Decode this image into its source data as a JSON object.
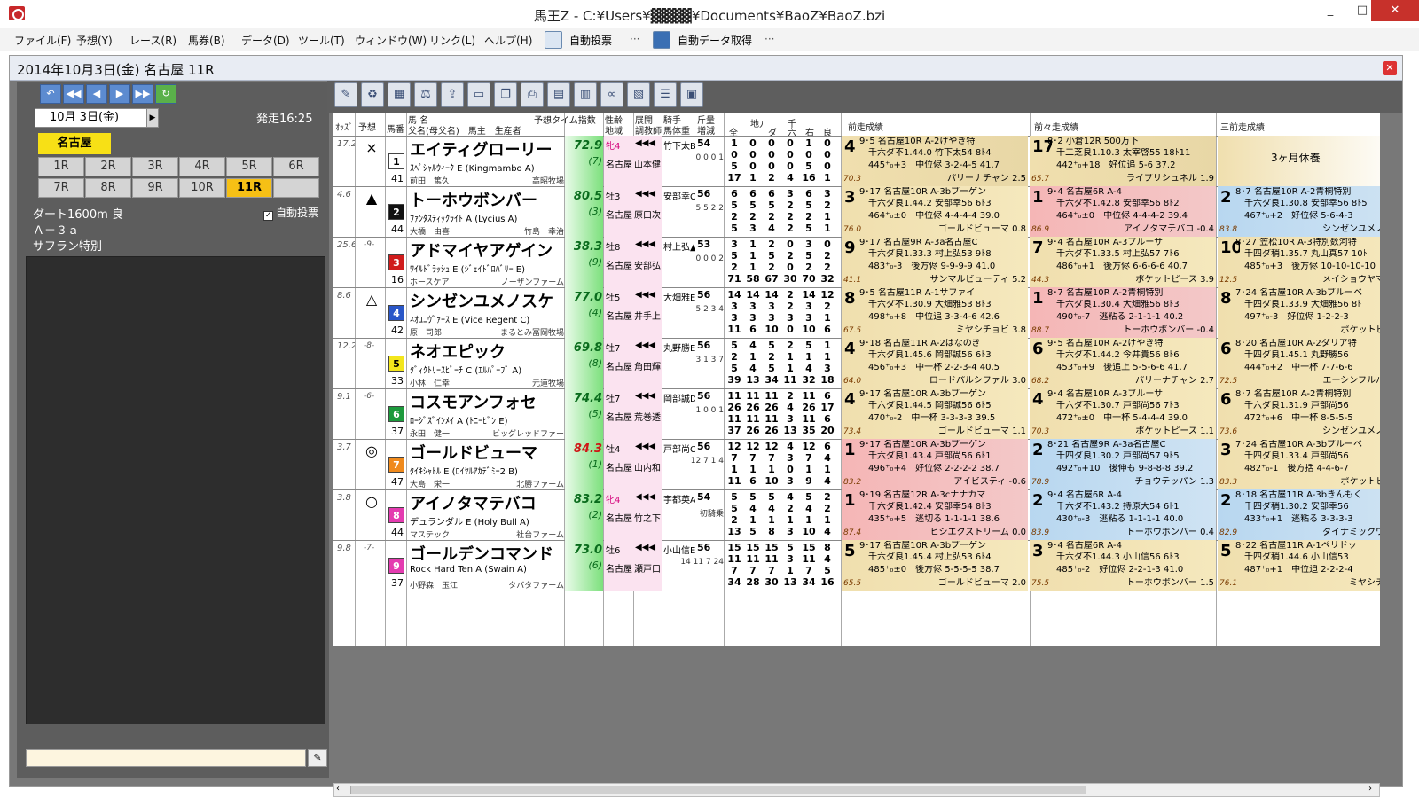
{
  "window": {
    "title": "馬王Z - C:¥Users¥▓▓▓▓¥Documents¥BaoZ¥BaoZ.bzi",
    "min": "_",
    "max": "□",
    "close": "✕"
  },
  "menu": [
    "ファイル(F)",
    "予想(Y)",
    "レース(R)",
    "馬券(B)",
    "データ(D)",
    "ツール(T)",
    "ウィンドウ(W)",
    "リンク(L)",
    "ヘルプ(H)"
  ],
  "toolbar": {
    "autovote": "自動投票",
    "autodata": "自動データ取得",
    "dots": "···"
  },
  "race": {
    "title": "2014年10月3日(金) 名古屋 11R",
    "date": "10月 3日(金)",
    "post_time": "発走16:25",
    "venue": "名古屋",
    "course": "ダート1600m 良",
    "class": "Ａ－３ａ",
    "name": "サフラン特別",
    "auto_vote": "自動投票"
  },
  "races": [
    "1R",
    "2R",
    "3R",
    "4R",
    "5R",
    "6R",
    "7R",
    "8R",
    "9R",
    "10R",
    "11R",
    ""
  ],
  "selected_race": "11R",
  "colors": {
    "accent": "#f6c015",
    "venue": "#f7e016",
    "index_green": "#7ce07c"
  },
  "header": {
    "odds": "ｵｯｽﾞ",
    "yoso": "予想",
    "waku": "馬番",
    "name": "馬 名",
    "sire": "父名(母父名)　馬主　生産者",
    "tindex": "予想タイム指数",
    "sexage": "性齢",
    "chiiki": "地域",
    "kyakushitsu": "展開",
    "chokyo": "調教師",
    "kishu": "騎手",
    "bataiju": "馬体重",
    "kinryo": "斤量",
    "zogen": "増減",
    "all": "全",
    "chiho": "地方",
    "da": "ダ",
    "sen": "千",
    "roku": "六",
    "migi": "右",
    "ryo": "良",
    "prev1": "前走成績",
    "prev2": "前々走成績",
    "prev3": "三前走成績"
  },
  "horses": [
    {
      "odds": "17.2",
      "pop": "",
      "mark": "×",
      "num": "1",
      "num_bg": "#ffffff",
      "num_fg": "#000",
      "weight_age": "41",
      "name": "エイティグローリー",
      "sire": "ｽﾍﾟｼｬﾙｳｨｰｸ E (Kingmambo A)",
      "owner": "前田　篤久",
      "breeder": "高昭牧場",
      "index": "72.9",
      "index_pop": "(7)",
      "sex": "牝4",
      "sex_pink": true,
      "area": "名古屋",
      "trainer": "山本健",
      "jockey": "竹下太B",
      "kin": "54",
      "body": "0 0 0 1",
      "stats": [
        [
          "1",
          "0",
          "0",
          "0",
          "1",
          "0"
        ],
        [
          "0",
          "0",
          "0",
          "0",
          "0",
          "0"
        ],
        [
          "5",
          "0",
          "0",
          "0",
          "5",
          "0"
        ],
        [
          "17",
          "1",
          "2",
          "4",
          "16",
          "1"
        ]
      ],
      "p1": {
        "pos": "4",
        "l1": "9･5 名古屋10R A-2けやき特",
        "l2": "千六ダ不1.44.0 竹下太54 8ﾄ4",
        "l3": "445⁺₀+3　中位侭 3-2-4-5 41.7",
        "l4": "パリーナチャン 2.5",
        "r": "70.3",
        "bg": "#e8d7a6"
      },
      "p2": {
        "pos": "17",
        "l1": "8･2 小倉12R 500万下",
        "l2": "千二芝良1.10.3 太宰啓55 18ﾄ11",
        "l3": "442⁺₀+18　好位追 5-6 37.2",
        "l4": "ライブリシュネル 1.9",
        "r": "65.7",
        "bg": "#e8d7a6"
      },
      "p3": {
        "pos": "",
        "l1": "",
        "l2": "3ヶ月休養",
        "l3": "",
        "l4": "",
        "r": "",
        "bg": "#ffffff"
      }
    },
    {
      "odds": "4.6",
      "pop": "",
      "mark": "▲",
      "num": "2",
      "num_bg": "#111111",
      "num_fg": "#fff",
      "weight_age": "44",
      "name": "トーホウボンバー",
      "sire": "ﾌｧﾝﾀｽﾃｨｯｸﾗｲﾄ A (Lycius A)",
      "owner": "大橋　由喜",
      "breeder": "竹島　幸治",
      "index": "80.5",
      "index_pop": "(3)",
      "sex": "牡3",
      "sex_pink": false,
      "area": "名古屋",
      "trainer": "原口次",
      "jockey": "安部幸C",
      "kin": "56",
      "body": "5 5 2 2",
      "stats": [
        [
          "6",
          "6",
          "6",
          "3",
          "6",
          "3"
        ],
        [
          "5",
          "5",
          "5",
          "2",
          "5",
          "2"
        ],
        [
          "2",
          "2",
          "2",
          "2",
          "2",
          "1"
        ],
        [
          "5",
          "3",
          "4",
          "2",
          "5",
          "1"
        ]
      ],
      "p1": {
        "pos": "3",
        "l1": "9･17 名古屋10R A-3bブーゲン",
        "l2": "千六ダ良1.44.2 安部幸56 6ﾄ3",
        "l3": "464⁺₀±0　中位侭 4-4-4-4 39.0",
        "l4": "ゴールドビューマ 0.8",
        "r": "76.0",
        "bg": "#f5e8bd"
      },
      "p2": {
        "pos": "1",
        "l1": "9･4 名古屋6R A-4",
        "l2": "千六ダ不1.42.8 安部幸56 8ﾄ2",
        "l3": "464⁺₀±0　中位侭 4-4-4-2 39.4",
        "l4": "アイノタマテバコ -0.4",
        "r": "86.9",
        "bg": "#f3c8c8"
      },
      "p3": {
        "pos": "2",
        "l1": "8･7 名古屋10R A-2青桐特別",
        "l2": "千六ダ良1.30.8 安部幸56 8ﾄ5",
        "l3": "467⁺₀+2　好位侭 5-6-4-3 ",
        "l4": "シンゼンユメノスク",
        "r": "83.8",
        "bg": "#cfe3f3"
      }
    },
    {
      "odds": "25.6",
      "pop": "-9-",
      "mark": "",
      "num": "3",
      "num_bg": "#d01c1c",
      "num_fg": "#fff",
      "weight_age": "16",
      "name": "アドマイヤアゲイン",
      "sire": "ﾜｲﾙﾄﾞﾗｯｼｭ E (ｼﾞｪｲﾄﾞﾛﾊﾞﾘｰ E)",
      "owner": "ホースケア",
      "breeder": "ノーザンファーム",
      "index": "38.3",
      "index_pop": "(9)",
      "sex": "牡8",
      "sex_pink": false,
      "area": "名古屋",
      "trainer": "安部弘",
      "jockey": "村上弘▲",
      "kin": "53",
      "body": "0 0 0 2",
      "stats": [
        [
          "3",
          "1",
          "2",
          "0",
          "3",
          "0"
        ],
        [
          "5",
          "1",
          "5",
          "2",
          "5",
          "2"
        ],
        [
          "2",
          "1",
          "2",
          "0",
          "2",
          "2"
        ],
        [
          "71",
          "58",
          "67",
          "30",
          "70",
          "32"
        ]
      ],
      "p1": {
        "pos": "9",
        "l1": "9･17 名古屋9R A-3a名古屋C",
        "l2": "千六ダ良1.33.3 村上弘53 9ﾄ8",
        "l3": "483⁺₀-3　後方侭 9-9-9-9 41.0",
        "l4": "サンマルビューティ 5.2",
        "r": "41.1",
        "bg": "#f5e8bd"
      },
      "p2": {
        "pos": "7",
        "l1": "9･4 名古屋10R A-3ブルーサ",
        "l2": "千六ダ不1.33.5 村上弘57 7ﾄ6",
        "l3": "486⁺₀+1　後方侭 6-6-6-6 40.7",
        "l4": "ポケットピース 3.9",
        "r": "44.3",
        "bg": "#f5e8bd"
      },
      "p3": {
        "pos": "10",
        "l1": "8･27 笠松10R A-3特別数河特",
        "l2": "千四ダ稍1.35.7 丸山真57 10ﾄ",
        "l3": "485⁺₀+3　後方侭 10-10-10-10",
        "l4": "メイショウヤマナミ",
        "r": "12.5",
        "bg": "#f5e8bd"
      }
    },
    {
      "odds": "8.6",
      "pop": "",
      "mark": "△",
      "num": "4",
      "num_bg": "#2a57c8",
      "num_fg": "#fff",
      "weight_age": "42",
      "name": "シンゼンユメノスケ",
      "sire": "ﾈｵﾕﾆｳﾞｧｰｽ E (Vice Regent C)",
      "owner": "原　司郎",
      "breeder": "まるとみ冨岡牧場",
      "index": "77.0",
      "index_pop": "(4)",
      "sex": "牡5",
      "sex_pink": false,
      "area": "名古屋",
      "trainer": "井手上",
      "jockey": "大畑雅E",
      "kin": "56",
      "body": "5 2 3 4",
      "stats": [
        [
          "14",
          "14",
          "14",
          "2",
          "14",
          "12"
        ],
        [
          "3",
          "3",
          "3",
          "2",
          "3",
          "2"
        ],
        [
          "3",
          "3",
          "3",
          "3",
          "3",
          "1"
        ],
        [
          "11",
          "6",
          "10",
          "0",
          "10",
          "6"
        ]
      ],
      "p1": {
        "pos": "8",
        "l1": "9･5 名古屋11R A-1サファイ",
        "l2": "千六ダ不1.30.9 大畑雅53 8ﾄ3",
        "l3": "498⁺₀+8　中位追 3-3-4-6 42.6",
        "l4": "ミヤシチョビ 3.8",
        "r": "67.5",
        "bg": "#f5e8bd"
      },
      "p2": {
        "pos": "1",
        "l1": "8･7 名古屋10R A-2青桐特別",
        "l2": "千六ダ良1.30.4 大畑雅56 8ﾄ3",
        "l3": "490⁺₀-7　逃粘る 2-1-1-1 40.2",
        "l4": "トーホウボンバー -0.4",
        "r": "88.7",
        "bg": "#f3c8c8"
      },
      "p3": {
        "pos": "8",
        "l1": "7･24 名古屋10R A-3bブルーベ",
        "l2": "千四ダ良1.33.9 大畑雅56 8ﾄ",
        "l3": "497⁺₀-3　好位侭 1-2-2-3",
        "l4": "ポケットピース",
        "r": "",
        "bg": "#f5e8bd"
      }
    },
    {
      "odds": "12.2",
      "pop": "-8-",
      "mark": "",
      "num": "5",
      "num_bg": "#f3e61c",
      "num_fg": "#000",
      "weight_age": "33",
      "name": "ネオエピック",
      "sire": "ｸﾞｨｸﾄﾘｰｽﾋﾟｰﾁ C (ｴﾙﾊﾟｰﾌﾞ A)",
      "owner": "小林　仁幸",
      "breeder": "元道牧場",
      "index": "69.8",
      "index_pop": "(8)",
      "sex": "牡7",
      "sex_pink": false,
      "area": "名古屋",
      "trainer": "角田輝",
      "jockey": "丸野勝E",
      "kin": "56",
      "body": "3 1 3 7",
      "stats": [
        [
          "5",
          "4",
          "5",
          "2",
          "5",
          "1"
        ],
        [
          "2",
          "1",
          "2",
          "1",
          "1",
          "1"
        ],
        [
          "5",
          "4",
          "5",
          "1",
          "4",
          "3"
        ],
        [
          "39",
          "13",
          "34",
          "11",
          "32",
          "18"
        ]
      ],
      "p1": {
        "pos": "4",
        "l1": "9･18 名古屋11R A-2はなのき",
        "l2": "千六ダ良1.45.6 岡部誠56 6ﾄ3",
        "l3": "456⁺₀+3　中一杯 2-2-3-4 40.5",
        "l4": "ロードパルシファル 3.0",
        "r": "64.0",
        "bg": "#f5e8bd"
      },
      "p2": {
        "pos": "6",
        "l1": "9･5 名古屋10R A-2けやき特",
        "l2": "千六ダ不1.44.2 今井貴56 8ﾄ6",
        "l3": "453⁺₀+9　後追上 5-5-6-6 41.7",
        "l4": "パリーナチャン 2.7",
        "r": "68.2",
        "bg": "#f5e8bd"
      },
      "p3": {
        "pos": "6",
        "l1": "8･20 名古屋10R A-2ダリア特",
        "l2": "千四ダ良1.45.1 丸野勝56",
        "l3": "444⁺₀+2　中一杯 7-7-6-6",
        "l4": "エーシンフルハウス",
        "r": "72.5",
        "bg": "#f5e8bd"
      }
    },
    {
      "odds": "9.1",
      "pop": "-6-",
      "mark": "",
      "num": "6",
      "num_bg": "#1c9a3c",
      "num_fg": "#fff",
      "weight_age": "37",
      "name": "コスモアンフォセ",
      "sire": "ﾛｰｼﾞｽﾞｲﾝﾒｲ A (ﾄﾆｰﾋﾞﾝ E)",
      "owner": "永田　健一",
      "breeder": "ビッグレッドファー",
      "index": "74.4",
      "index_pop": "(5)",
      "sex": "牡7",
      "sex_pink": false,
      "area": "名古屋",
      "trainer": "荒巻透",
      "jockey": "岡部誠D",
      "kin": "56",
      "body": "1 0 0 1",
      "stats": [
        [
          "11",
          "11",
          "11",
          "2",
          "11",
          "6"
        ],
        [
          "26",
          "26",
          "26",
          "4",
          "26",
          "17"
        ],
        [
          "11",
          "11",
          "11",
          "3",
          "11",
          "6"
        ],
        [
          "37",
          "26",
          "26",
          "13",
          "35",
          "20"
        ]
      ],
      "p1": {
        "pos": "4",
        "l1": "9･17 名古屋10R A-3bブーゲン",
        "l2": "千六ダ良1.44.5 岡部誠56 6ﾄ5",
        "l3": "470⁺₀-2　中一杯 3-3-3-3 39.5",
        "l4": "ゴールドビューマ 1.1",
        "r": "73.4",
        "bg": "#f5e8bd"
      },
      "p2": {
        "pos": "4",
        "l1": "9･4 名古屋10R A-3ブルーサ",
        "l2": "千六ダ不1.30.7 戸部尚56 7ﾄ3",
        "l3": "472⁺₀±0　中一杯 5-4-4-4 39.0",
        "l4": "ポケットピース 1.1",
        "r": "70.3",
        "bg": "#f5e8bd"
      },
      "p3": {
        "pos": "6",
        "l1": "8･7 名古屋10R A-2青桐特別",
        "l2": "千六ダ良1.31.9 戸部尚56",
        "l3": "472⁺₀+6　中一杯 8-5-5-5",
        "l4": "シンゼンユメノスク",
        "r": "73.6",
        "bg": "#f5e8bd"
      }
    },
    {
      "odds": "3.7",
      "pop": "",
      "mark": "◎",
      "num": "7",
      "num_bg": "#f08a1c",
      "num_fg": "#fff",
      "weight_age": "47",
      "name": "ゴールドビューマ",
      "sire": "ﾀｲｷｼｬﾄﾙ E (ﾛｲﾔﾙｱｶﾃﾞﾐｰ2 B)",
      "owner": "大島　栄一",
      "breeder": "北勝ファーム",
      "index": "84.3",
      "index_pop": "(1)",
      "sex": "牡4",
      "sex_pink": false,
      "area": "名古屋",
      "trainer": "山内和",
      "jockey": "戸部尚C",
      "kin": "56",
      "body": "12 7 1 4",
      "stats": [
        [
          "12",
          "12",
          "12",
          "4",
          "12",
          "6"
        ],
        [
          "7",
          "7",
          "7",
          "3",
          "7",
          "4"
        ],
        [
          "1",
          "1",
          "1",
          "0",
          "1",
          "1"
        ],
        [
          "11",
          "6",
          "10",
          "3",
          "9",
          "4"
        ]
      ],
      "p1": {
        "pos": "1",
        "l1": "9･17 名古屋10R A-3bブーゲン",
        "l2": "千六ダ良1.43.4 戸部尚56 6ﾄ1",
        "l3": "496⁺₀+4　好位侭 2-2-2-2 38.7",
        "l4": "アイビスティ -0.6",
        "r": "83.2",
        "bg": "#f3c8c8"
      },
      "p2": {
        "pos": "2",
        "l1": "8･21 名古屋9R A-3a名古屋C",
        "l2": "千四ダ良1.30.2 戸部尚57 9ﾄ5",
        "l3": "492⁺₀+10　後伸も 9-8-8-8 39.2",
        "l4": "チョウテッパン 1.3",
        "r": "78.9",
        "bg": "#cfe3f3"
      },
      "p3": {
        "pos": "3",
        "l1": "7･24 名古屋10R A-3bブルーベ",
        "l2": "千四ダ良1.33.4 戸部尚56",
        "l3": "482⁺₀-1　後方括 4-4-6-7",
        "l4": "ポケットピース",
        "r": "83.3",
        "bg": "#f5e8bd"
      }
    },
    {
      "odds": "3.8",
      "pop": "",
      "mark": "○",
      "num": "8",
      "num_bg": "#e43bb0",
      "num_fg": "#fff",
      "weight_age": "44",
      "name": "アイノタマテバコ",
      "sire": "デュランダル E (Holy Bull A)",
      "owner": "マステック",
      "breeder": "社台ファーム",
      "index": "83.2",
      "index_pop": "(2)",
      "sex": "牝4",
      "sex_pink": true,
      "area": "名古屋",
      "trainer": "竹之下",
      "jockey": "宇都英A",
      "kin": "54",
      "body": "初騎乗",
      "stats": [
        [
          "5",
          "5",
          "5",
          "4",
          "5",
          "2"
        ],
        [
          "5",
          "4",
          "4",
          "2",
          "4",
          "2"
        ],
        [
          "2",
          "1",
          "1",
          "1",
          "1",
          "1"
        ],
        [
          "13",
          "5",
          "8",
          "3",
          "10",
          "4"
        ]
      ],
      "p1": {
        "pos": "1",
        "l1": "9･19 名古屋12R A-3cナナカマ",
        "l2": "千六ダ良1.42.4 安部幸54 8ﾄ3",
        "l3": "435⁺₀+5　逃切る 1-1-1-1 38.6",
        "l4": "ヒシエクストリーム 0.0",
        "r": "87.4",
        "bg": "#f3c8c8"
      },
      "p2": {
        "pos": "2",
        "l1": "9･4 名古屋6R A-4",
        "l2": "千六ダ不1.43.2 持原大54 6ﾄ1",
        "l3": "430⁺₀-3　逃粘る 1-1-1-1 40.0",
        "l4": "トーホウボンバー 0.4",
        "r": "83.9",
        "bg": "#cfe3f3"
      },
      "p3": {
        "pos": "2",
        "l1": "8･18 名古屋11R A-3bきんもく",
        "l2": "千四ダ稍1.30.2 安部幸56",
        "l3": "433⁺₀+1　逃粘る 3-3-3-3",
        "l4": "ダイナミックワルツ",
        "r": "82.9",
        "bg": "#cfe3f3"
      }
    },
    {
      "odds": "9.8",
      "pop": "-7-",
      "mark": "",
      "num": "9",
      "num_bg": "#e43bb0",
      "num_fg": "#fff",
      "weight_age": "37",
      "name": "ゴールデンコマンド",
      "sire": "Rock Hard Ten A (Swain A)",
      "owner": "小野森　玉江",
      "breeder": "タバタファーム",
      "index": "73.0",
      "index_pop": "(6)",
      "sex": "牡6",
      "sex_pink": false,
      "area": "名古屋",
      "trainer": "瀬戸口",
      "jockey": "小山信E",
      "kin": "56",
      "body": "14 11 7 24",
      "stats": [
        [
          "15",
          "15",
          "15",
          "5",
          "15",
          "8"
        ],
        [
          "11",
          "11",
          "11",
          "3",
          "11",
          "4"
        ],
        [
          "7",
          "7",
          "7",
          "1",
          "7",
          "5"
        ],
        [
          "34",
          "28",
          "30",
          "13",
          "34",
          "16"
        ]
      ],
      "p1": {
        "pos": "5",
        "l1": "9･17 名古屋10R A-3bブーゲン",
        "l2": "千六ダ良1.45.4 村上弘53 6ﾄ4",
        "l3": "485⁺₀±0　後方侭 5-5-5-5 38.7",
        "l4": "ゴールドビューマ 2.0",
        "r": "65.5",
        "bg": "#f5e8bd"
      },
      "p2": {
        "pos": "3",
        "l1": "9･4 名古屋6R A-4",
        "l2": "千六ダ不1.44.3 小山信56 6ﾄ3",
        "l3": "485⁺₀-2　好位侭 2-2-1-3 41.0",
        "l4": "トーホウボンバー 1.5",
        "r": "75.5",
        "bg": "#f5e8bd"
      },
      "p3": {
        "pos": "5",
        "l1": "8･22 名古屋11R A-1ペリドッ",
        "l2": "千四ダ稍1.44.6 小山信53",
        "l3": "487⁺₀+1　中位迫 2-2-2-4",
        "l4": "ミヤシチョビ",
        "r": "76.1",
        "bg": "#f5e8bd"
      }
    }
  ]
}
